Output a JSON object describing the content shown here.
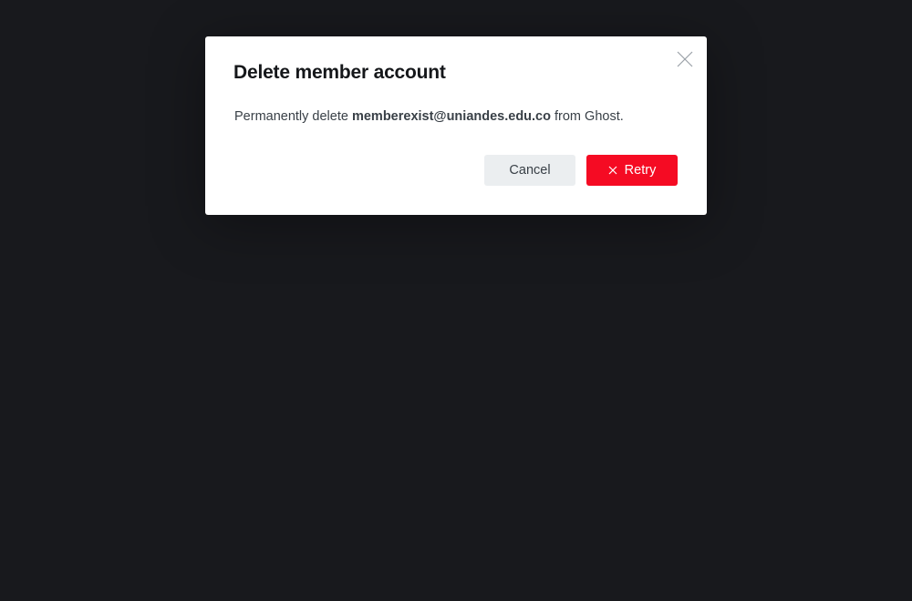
{
  "dialog": {
    "title": "Delete member account",
    "message_prefix": "Permanently delete ",
    "member_email": "memberexist@uniandes.edu.co",
    "message_suffix": " from Ghost.",
    "close_icon": "close-icon",
    "cancel_label": "Cancel",
    "retry_label": "Retry",
    "retry_icon": "close-icon"
  },
  "colors": {
    "backdrop": "#18191d",
    "danger": "#f50b23",
    "cancel_bg": "#ebeef0"
  }
}
